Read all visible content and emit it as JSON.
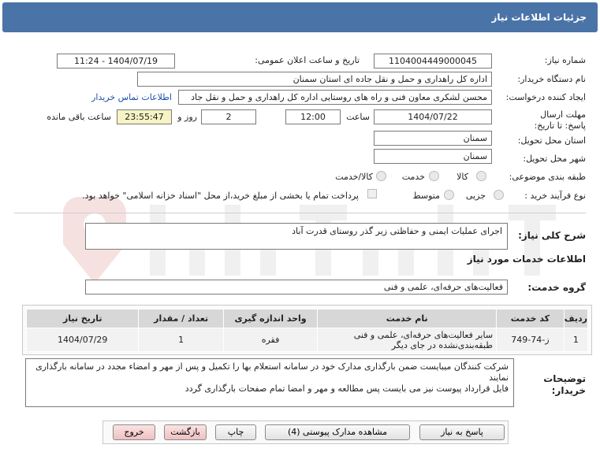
{
  "header": {
    "title": "جزئیات اطلاعات نیاز"
  },
  "fields": {
    "need_number_label": "شماره نیاز:",
    "need_number": "1104004449000045",
    "announce_label": "تاریخ و ساعت اعلان عمومی:",
    "announce_value": "1404/07/19 - 11:24",
    "buyer_label": "نام دستگاه خریدار:",
    "buyer_value": "اداره کل راهداری و حمل و نقل جاده ای استان سمنان",
    "creator_label": "ایجاد کننده درخواست:",
    "creator_value": "محسن لشکری معاون فنی و راه های روستایی اداره کل راهداری و حمل و نقل جاد",
    "contact_link": "اطلاعات تماس خریدار",
    "deadline_label": "مهلت ارسال پاسخ: تا تاریخ:",
    "deadline_date": "1404/07/22",
    "time_label": "ساعت",
    "deadline_time": "12:00",
    "days_value": "2",
    "days_label": "روز و",
    "remaining_value": "23:55:47",
    "remaining_label": "ساعت باقی مانده",
    "province_label": "استان محل تحویل:",
    "province_value": "سمنان",
    "city_label": "شهر محل تحویل:",
    "city_value": "سمنان",
    "category_label": "طبقه بندی موضوعی:",
    "cat_goods": "کالا",
    "cat_service": "خدمت",
    "cat_goods_service": "کالا/خدمت",
    "process_label": "نوع فرآیند خرید :",
    "proc_partial": "جزیی",
    "proc_medium": "متوسط",
    "payment_note": "پرداخت تمام یا بخشی از مبلغ خرید،از محل \"اسناد خزانه اسلامی\" خواهد بود."
  },
  "summary": {
    "label": "شرح کلی نیاز:",
    "value": "اجرای عملیات ایمنی و حفاظتی زیر گذر روستای قدرت آباد"
  },
  "services_title": "اطلاعات خدمات مورد نیاز",
  "service_group": {
    "label": "گروه خدمت:",
    "value": "فعالیت‌های حرفه‌ای، علمی و فنی"
  },
  "table": {
    "headers": [
      "ردیف",
      "کد خدمت",
      "نام خدمت",
      "واحد اندازه گیری",
      "تعداد / مقدار",
      "تاریخ نیاز"
    ],
    "rows": [
      {
        "row": "1",
        "code": "ز-74-749",
        "name": "سایر فعالیت‌های حرفه‌ای، علمی و فنی طبقه‌بندی‌نشده در جای دیگر",
        "unit": "فقره",
        "qty": "1",
        "date": "1404/07/29"
      }
    ]
  },
  "description": {
    "label": "توضیحات خریدار:",
    "line1": "شرکت کنندگان میبایست ضمن بارگذاری مدارک خود در سامانه استعلام بها را تکمیل و پس از مهر و امضاء مجدد در سامانه بارگذاری نمایند",
    "line2": "فایل قرارداد پیوست نیز می بایست پس مطالعه و مهر و امضا تمام صفحات بارگذاری گردد"
  },
  "buttons": {
    "reply": "پاسخ به نیاز",
    "attachments": "مشاهده مدارک پیوستی (4)",
    "print": "چاپ",
    "back": "بازگشت",
    "exit": "خروج"
  }
}
